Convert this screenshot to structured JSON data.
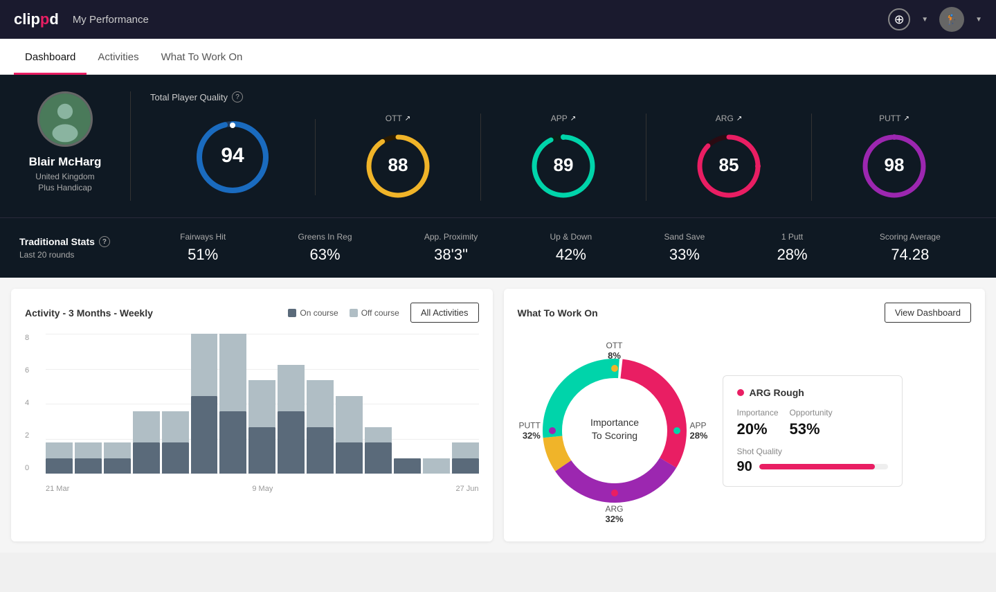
{
  "app": {
    "logo": "clippd",
    "header_title": "My Performance"
  },
  "nav": {
    "tabs": [
      {
        "label": "Dashboard",
        "active": true
      },
      {
        "label": "Activities",
        "active": false
      },
      {
        "label": "What To Work On",
        "active": false
      }
    ]
  },
  "player": {
    "name": "Blair McHarg",
    "country": "United Kingdom",
    "handicap": "Plus Handicap",
    "avatar_icon": "👤"
  },
  "quality": {
    "label": "Total Player Quality",
    "main_score": 94,
    "metrics": [
      {
        "key": "OTT",
        "value": 88,
        "color": "#f0b429",
        "bg": "#2a2a1a"
      },
      {
        "key": "APP",
        "value": 89,
        "color": "#00d4aa",
        "bg": "#0a1f1a"
      },
      {
        "key": "ARG",
        "value": 85,
        "color": "#e91e63",
        "bg": "#1f0a12"
      },
      {
        "key": "PUTT",
        "value": 98,
        "color": "#9c27b0",
        "bg": "#1a0a1f"
      }
    ]
  },
  "trad_stats": {
    "label": "Traditional Stats",
    "sublabel": "Last 20 rounds",
    "items": [
      {
        "name": "Fairways Hit",
        "value": "51%"
      },
      {
        "name": "Greens In Reg",
        "value": "63%"
      },
      {
        "name": "App. Proximity",
        "value": "38'3\""
      },
      {
        "name": "Up & Down",
        "value": "42%"
      },
      {
        "name": "Sand Save",
        "value": "33%"
      },
      {
        "name": "1 Putt",
        "value": "28%"
      },
      {
        "name": "Scoring Average",
        "value": "74.28"
      }
    ]
  },
  "activity_chart": {
    "title": "Activity - 3 Months - Weekly",
    "legend_on": "On course",
    "legend_off": "Off course",
    "all_activities_btn": "All Activities",
    "y_labels": [
      "8",
      "6",
      "4",
      "2",
      "0"
    ],
    "x_labels": [
      "21 Mar",
      "",
      "9 May",
      "",
      "27 Jun"
    ],
    "bars": [
      {
        "on": 1,
        "off": 1
      },
      {
        "on": 1,
        "off": 1
      },
      {
        "on": 1,
        "off": 1
      },
      {
        "on": 2,
        "off": 2
      },
      {
        "on": 2,
        "off": 2
      },
      {
        "on": 5,
        "off": 4
      },
      {
        "on": 4,
        "off": 5
      },
      {
        "on": 3,
        "off": 3
      },
      {
        "on": 4,
        "off": 3
      },
      {
        "on": 3,
        "off": 3
      },
      {
        "on": 2,
        "off": 3
      },
      {
        "on": 2,
        "off": 1
      },
      {
        "on": 1,
        "off": 0
      },
      {
        "on": 0,
        "off": 1
      },
      {
        "on": 1,
        "off": 1
      }
    ],
    "max_val": 9
  },
  "work_on": {
    "title": "What To Work On",
    "view_dashboard_btn": "View Dashboard",
    "donut_center": "Importance\nTo Scoring",
    "segments": [
      {
        "key": "OTT",
        "pct": 8,
        "color": "#f0b429",
        "pos": "top"
      },
      {
        "key": "APP",
        "pct": 28,
        "color": "#00d4aa",
        "pos": "right"
      },
      {
        "key": "ARG",
        "pct": 32,
        "color": "#e91e63",
        "pos": "bottom"
      },
      {
        "key": "PUTT",
        "pct": 32,
        "color": "#9c27b0",
        "pos": "left"
      }
    ],
    "info_card": {
      "title": "ARG Rough",
      "importance_label": "Importance",
      "importance_val": "20%",
      "opportunity_label": "Opportunity",
      "opportunity_val": "53%",
      "shot_quality_label": "Shot Quality",
      "shot_quality_val": "90",
      "shot_quality_pct": 90
    }
  }
}
